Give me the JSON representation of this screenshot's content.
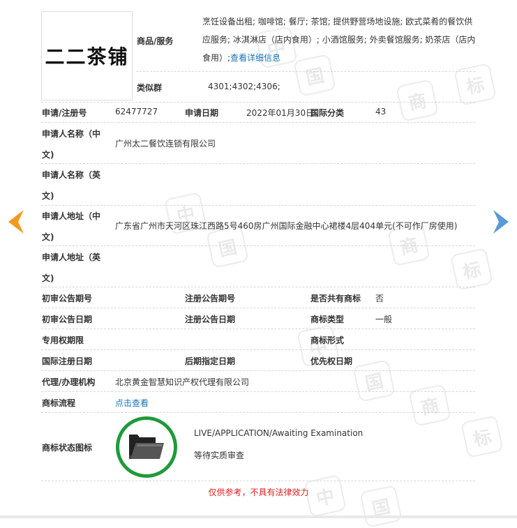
{
  "logo_text": "二二茶铺",
  "watermark": [
    "中",
    "国",
    "商",
    "标"
  ],
  "goods": {
    "label": "商品/服务",
    "text": "烹饪设备出租; 咖啡馆; 餐厅; 茶馆; 提供野营场地设施; 欧式菜肴的餐饮供应服务; 冰淇淋店（店内食用）; 小酒馆服务; 外卖餐馆服务; 奶茶店（店内食用）;",
    "detail_link": "查看详细信息"
  },
  "similar_group": {
    "label": "类似群",
    "value": "4301;4302;4306;"
  },
  "app_no": {
    "label": "申请/注册号",
    "value": "62477727"
  },
  "app_date": {
    "label": "申请日期",
    "value": "2022年01月30日"
  },
  "intl_class": {
    "label": "国际分类",
    "value": "43"
  },
  "applicant_cn": {
    "label_1": "申请人名称（中",
    "label_2": "文)",
    "value": "广州太二餐饮连锁有限公司"
  },
  "applicant_en": {
    "label_1": "申请人名称（英",
    "label_2": "文)",
    "value": ""
  },
  "address_cn": {
    "label_1": "申请人地址（中",
    "label_2": "文)",
    "value": "广东省广州市天河区珠江西路5号460房广州国际金融中心裙楼4层404单元(不可作厂房使用)"
  },
  "address_en": {
    "label_1": "申请人地址（英",
    "label_2": "文)",
    "value": ""
  },
  "prelim_no": {
    "label": "初审公告期号",
    "value": ""
  },
  "reg_no": {
    "label": "注册公告期号",
    "value": ""
  },
  "shared": {
    "label": "是否共有商标",
    "value": "否"
  },
  "prelim_date": {
    "label": "初审公告日期",
    "value": ""
  },
  "reg_date": {
    "label": "注册公告日期",
    "value": ""
  },
  "tm_type": {
    "label": "商标类型",
    "value": "一般"
  },
  "exclusive": {
    "label": "专用权期限",
    "value": ""
  },
  "tm_form": {
    "label": "商标形式",
    "value": ""
  },
  "intl_reg_date": {
    "label": "国际注册日期",
    "value": ""
  },
  "later_date": {
    "label": "后期指定日期",
    "value": ""
  },
  "priority_date": {
    "label": "优先权日期",
    "value": ""
  },
  "agency": {
    "label": "代理/办理机构",
    "value": "北京黄金智慧知识产权代理有限公司"
  },
  "flow": {
    "label": "商标流程",
    "link": "点击查看"
  },
  "status": {
    "label": "商标状态图标",
    "en": "LIVE/APPLICATION/Awaiting Examination",
    "cn": "等待实质审查",
    "icon": "folder-icon"
  },
  "notice": "仅供参考，不具有法律效力",
  "colors": {
    "prev_arrow": "#f39a1e",
    "next_arrow": "#5b9bd5",
    "status_ring": "#1f9a3a",
    "link": "#1a73b8",
    "notice": "#e02020"
  }
}
